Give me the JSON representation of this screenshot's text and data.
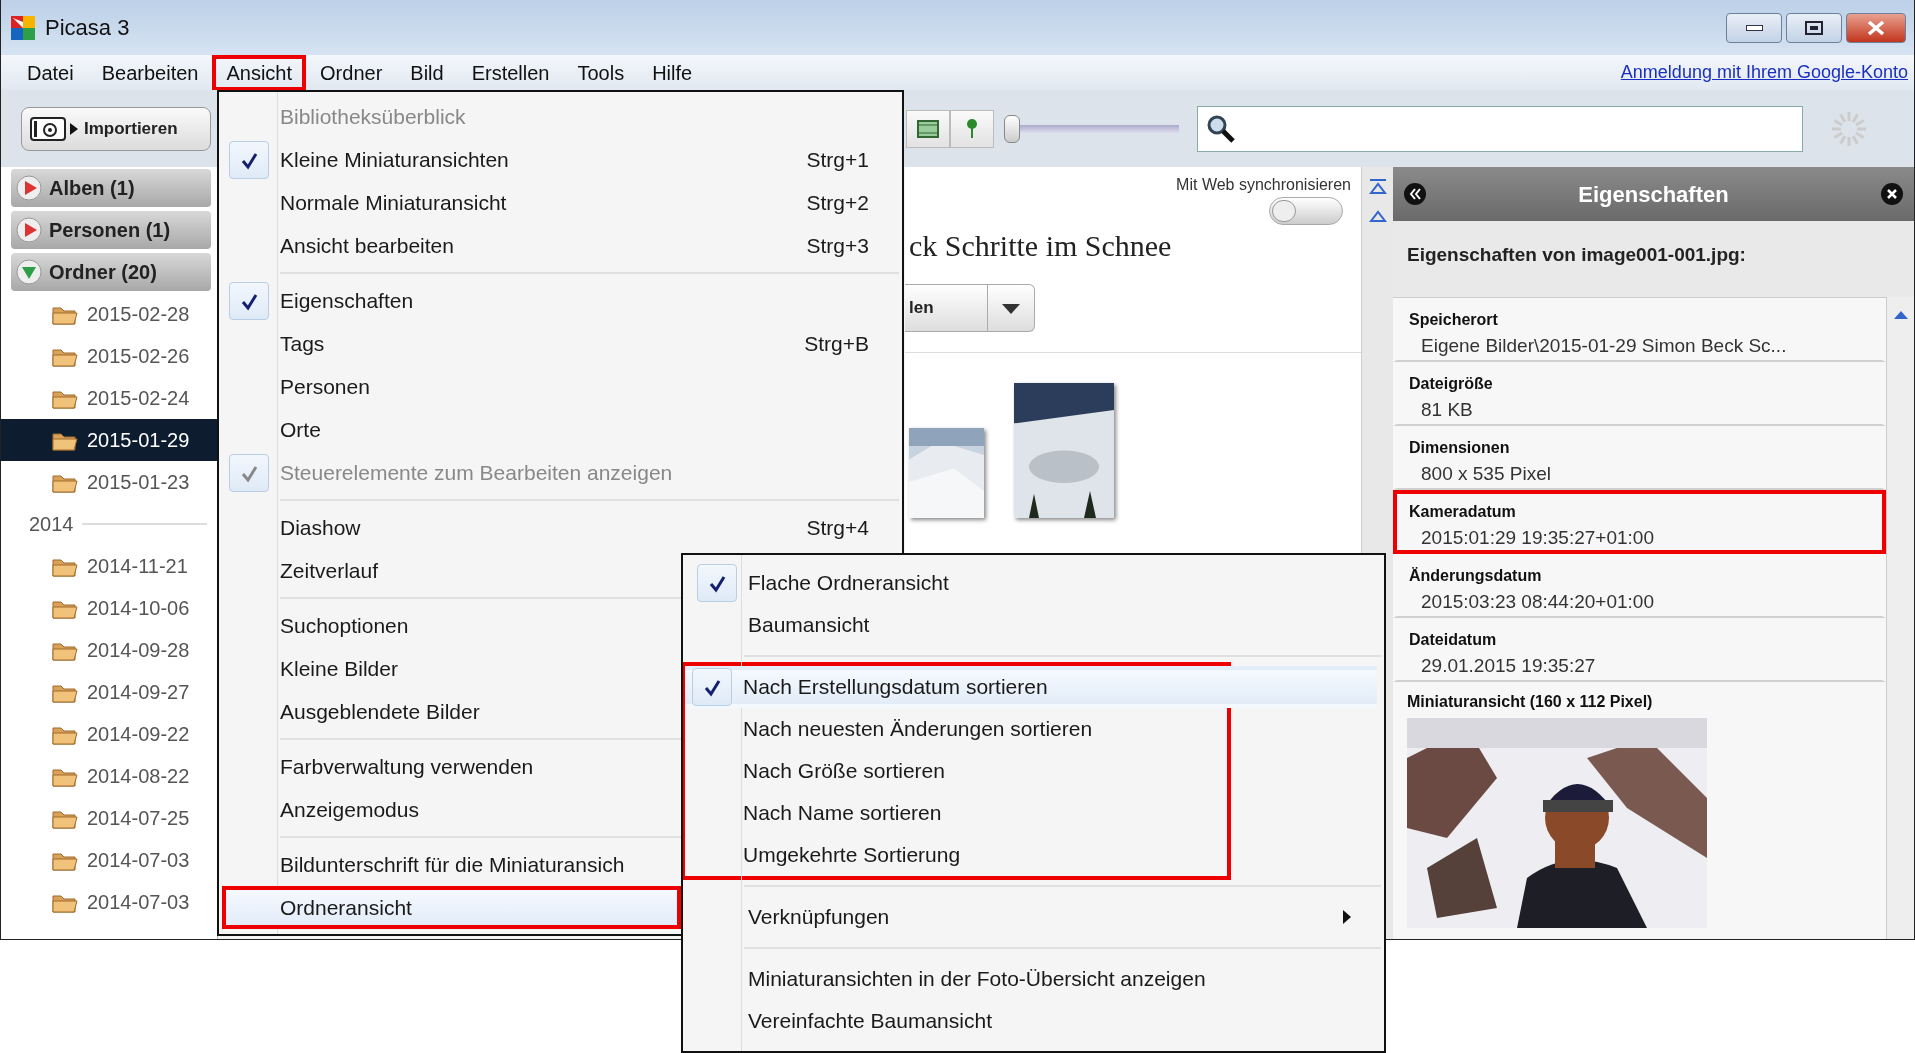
{
  "window": {
    "title": "Picasa 3"
  },
  "menu_bar": {
    "items": [
      {
        "label": "Datei",
        "highlighted": false
      },
      {
        "label": "Bearbeiten",
        "highlighted": false
      },
      {
        "label": "Ansicht",
        "highlighted": true
      },
      {
        "label": "Ordner",
        "highlighted": false
      },
      {
        "label": "Bild",
        "highlighted": false
      },
      {
        "label": "Erstellen",
        "highlighted": false
      },
      {
        "label": "Tools",
        "highlighted": false
      },
      {
        "label": "Hilfe",
        "highlighted": false
      }
    ],
    "account_link": "Anmeldung mit Ihrem Google-Konto"
  },
  "toolbar": {
    "import_button": "Importieren",
    "zoom_slider": {
      "level": 0
    }
  },
  "sidebar": {
    "sections": [
      {
        "label": "Alben (1)",
        "expanded": false
      },
      {
        "label": "Personen (1)",
        "expanded": false
      },
      {
        "label": "Ordner (20)",
        "expanded": true
      }
    ],
    "folders": [
      {
        "kind": "folder",
        "label": "2015-02-28",
        "selected": false
      },
      {
        "kind": "folder",
        "label": "2015-02-26",
        "selected": false
      },
      {
        "kind": "folder",
        "label": "2015-02-24",
        "selected": false
      },
      {
        "kind": "folder",
        "label": "2015-01-29",
        "selected": true
      },
      {
        "kind": "folder",
        "label": "2015-01-23",
        "selected": false
      },
      {
        "kind": "year",
        "label": "2014"
      },
      {
        "kind": "folder",
        "label": "2014-11-21",
        "selected": false
      },
      {
        "kind": "folder",
        "label": "2014-10-06",
        "selected": false
      },
      {
        "kind": "folder",
        "label": "2014-09-28",
        "selected": false
      },
      {
        "kind": "folder",
        "label": "2014-09-27",
        "selected": false
      },
      {
        "kind": "folder",
        "label": "2014-09-22",
        "selected": false
      },
      {
        "kind": "folder",
        "label": "2014-08-22",
        "selected": false
      },
      {
        "kind": "folder",
        "label": "2014-07-25",
        "selected": false
      },
      {
        "kind": "folder",
        "label": "2014-07-03",
        "selected": false
      },
      {
        "kind": "folder",
        "label": "2014-07-03",
        "selected": false
      }
    ]
  },
  "album": {
    "title": "ck Schritte im Schnee",
    "sync_label": "Mit Web synchronisieren",
    "sync": {
      "on": false
    },
    "split_button": "len"
  },
  "properties": {
    "title": "Eigenschaften",
    "subtitle": "Eigenschaften von image001-001.jpg:",
    "fields": [
      {
        "label": "Speicherort",
        "value": "Eigene Bilder\\2015-01-29 Simon Beck Sc...",
        "highlighted": false
      },
      {
        "label": "Dateigröße",
        "value": "81 KB",
        "highlighted": false
      },
      {
        "label": "Dimensionen",
        "value": "800 x 535 Pixel",
        "highlighted": false
      },
      {
        "label": "Kameradatum",
        "value": "2015:01:29 19:35:27+01:00",
        "highlighted": true
      },
      {
        "label": "Änderungsdatum",
        "value": "2015:03:23 08:44:20+01:00",
        "highlighted": false
      },
      {
        "label": "Dateidatum",
        "value": "29.01.2015 19:35:27",
        "highlighted": false
      }
    ],
    "thumbnail_label": "Miniaturansicht (160 x 112 Pixel)"
  },
  "view_menu": {
    "items": [
      {
        "kind": "item",
        "label": "Bibliotheksüberblick",
        "checked": false,
        "disabled": true,
        "selected": false,
        "highlighted": false
      },
      {
        "kind": "item",
        "label": "Kleine Miniaturansichten",
        "shortcut": "Strg+1",
        "checked": true,
        "disabled": false,
        "selected": false,
        "highlighted": false
      },
      {
        "kind": "item",
        "label": "Normale Miniaturansicht",
        "shortcut": "Strg+2",
        "checked": false,
        "disabled": false,
        "selected": false,
        "highlighted": false
      },
      {
        "kind": "item",
        "label": "Ansicht bearbeiten",
        "shortcut": "Strg+3",
        "checked": false,
        "disabled": false,
        "selected": false,
        "highlighted": false
      },
      {
        "kind": "separator"
      },
      {
        "kind": "item",
        "label": "Eigenschaften",
        "checked": true,
        "disabled": false,
        "selected": false,
        "highlighted": false
      },
      {
        "kind": "item",
        "label": "Tags",
        "shortcut": "Strg+B",
        "checked": false,
        "disabled": false,
        "selected": false,
        "highlighted": false
      },
      {
        "kind": "item",
        "label": "Personen",
        "checked": false,
        "disabled": false,
        "selected": false,
        "highlighted": false
      },
      {
        "kind": "item",
        "label": "Orte",
        "checked": false,
        "disabled": false,
        "selected": false,
        "highlighted": false
      },
      {
        "kind": "item",
        "label": "Steuerelemente zum Bearbeiten anzeigen",
        "checked": true,
        "disabled": true,
        "selected": false,
        "highlighted": false
      },
      {
        "kind": "separator"
      },
      {
        "kind": "item",
        "label": "Diashow",
        "shortcut": "Strg+4",
        "checked": false,
        "disabled": false,
        "selected": false,
        "highlighted": false
      },
      {
        "kind": "item",
        "label": "Zeitverlauf",
        "checked": false,
        "disabled": false,
        "selected": false,
        "highlighted": false
      },
      {
        "kind": "separator"
      },
      {
        "kind": "item",
        "label": "Suchoptionen",
        "checked": false,
        "disabled": false,
        "selected": false,
        "highlighted": false
      },
      {
        "kind": "item",
        "label": "Kleine Bilder",
        "checked": false,
        "disabled": false,
        "selected": false,
        "highlighted": false
      },
      {
        "kind": "item",
        "label": "Ausgeblendete Bilder",
        "checked": false,
        "disabled": false,
        "selected": false,
        "highlighted": false
      },
      {
        "kind": "separator"
      },
      {
        "kind": "item",
        "label": "Farbverwaltung verwenden",
        "checked": false,
        "disabled": false,
        "selected": false,
        "highlighted": false
      },
      {
        "kind": "item",
        "label": "Anzeigemodus",
        "checked": false,
        "disabled": false,
        "selected": false,
        "highlighted": false
      },
      {
        "kind": "separator"
      },
      {
        "kind": "item",
        "label": "Bildunterschrift für die Miniaturansich",
        "checked": false,
        "disabled": false,
        "selected": false,
        "highlighted": false
      },
      {
        "kind": "item",
        "label": "Ordneransicht",
        "checked": false,
        "disabled": false,
        "selected": true,
        "highlighted": true
      }
    ]
  },
  "folder_view_submenu": {
    "groups": [
      {
        "highlighted": false,
        "items": [
          {
            "label": "Flache Ordneransicht",
            "checked": true,
            "selected": false,
            "has_submenu": false
          },
          {
            "label": "Baumansicht",
            "checked": false,
            "selected": false,
            "has_submenu": false
          }
        ]
      },
      {
        "highlighted": true,
        "items": [
          {
            "label": "Nach Erstellungsdatum sortieren",
            "checked": true,
            "selected": true,
            "has_submenu": false
          },
          {
            "label": "Nach neuesten Änderungen sortieren",
            "checked": false,
            "selected": false,
            "has_submenu": false
          },
          {
            "label": "Nach Größe sortieren",
            "checked": false,
            "selected": false,
            "has_submenu": false
          },
          {
            "label": "Nach Name sortieren",
            "checked": false,
            "selected": false,
            "has_submenu": false
          },
          {
            "label": "Umgekehrte Sortierung",
            "checked": false,
            "selected": false,
            "has_submenu": false
          }
        ]
      },
      {
        "highlighted": false,
        "items": [
          {
            "label": "Verknüpfungen",
            "checked": false,
            "selected": false,
            "has_submenu": true
          }
        ]
      },
      {
        "highlighted": false,
        "items": [
          {
            "label": "Miniaturansichten in der Foto-Übersicht anzeigen",
            "checked": false,
            "selected": false,
            "has_submenu": false
          },
          {
            "label": "Vereinfachte Baumansicht",
            "checked": false,
            "selected": false,
            "has_submenu": false
          }
        ]
      }
    ]
  }
}
